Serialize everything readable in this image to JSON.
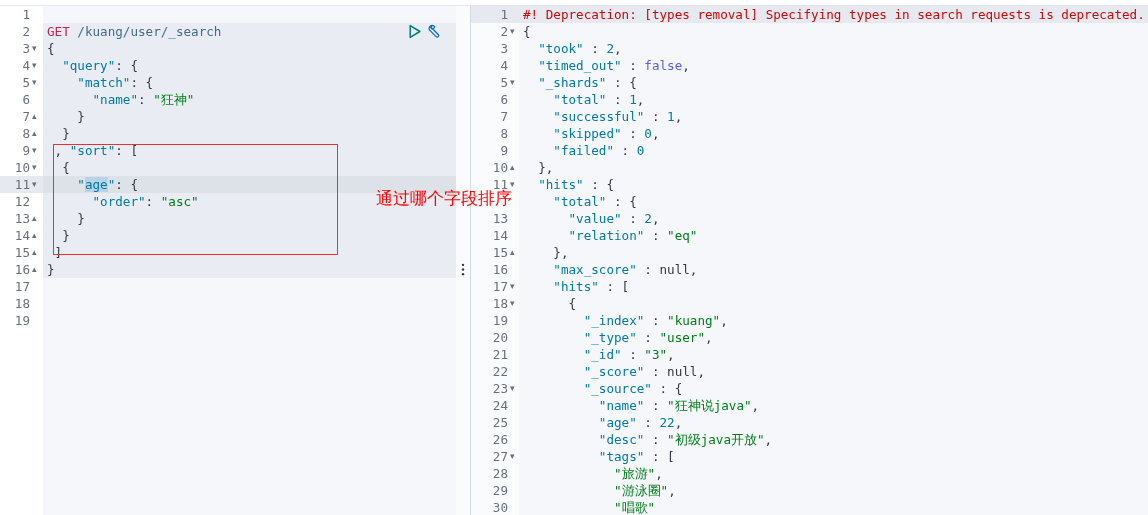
{
  "request_editor": {
    "lines": [
      {
        "number": "1",
        "in_request": false,
        "active": false
      },
      {
        "number": "2",
        "in_request": true,
        "active": false,
        "tokens": [
          {
            "kind": "method",
            "text": "GET"
          },
          {
            "kind": "url",
            "text": " /kuang/user/_search"
          }
        ]
      },
      {
        "number": "3",
        "fold": "▾",
        "in_request": true,
        "active": false,
        "tokens": [
          {
            "kind": "punct",
            "text": "{"
          }
        ]
      },
      {
        "number": "4",
        "fold": "▾",
        "in_request": true,
        "active": false,
        "tokens": [
          {
            "kind": "key",
            "text": "  \"query\""
          },
          {
            "kind": "punct",
            "text": ": {"
          }
        ]
      },
      {
        "number": "5",
        "fold": "▾",
        "in_request": true,
        "active": false,
        "tokens": [
          {
            "kind": "key",
            "text": "    \"match\""
          },
          {
            "kind": "punct",
            "text": ": {"
          }
        ]
      },
      {
        "number": "6",
        "in_request": true,
        "active": false,
        "tokens": [
          {
            "kind": "key",
            "text": "      \"name\""
          },
          {
            "kind": "punct",
            "text": ": "
          },
          {
            "kind": "string",
            "text": "\"狂神\""
          }
        ]
      },
      {
        "number": "7",
        "fold": "▴",
        "in_request": true,
        "active": false,
        "tokens": [
          {
            "kind": "punct",
            "text": "    }"
          }
        ]
      },
      {
        "number": "8",
        "fold": "▴",
        "in_request": true,
        "active": false,
        "tokens": [
          {
            "kind": "punct",
            "text": "  }"
          }
        ]
      },
      {
        "number": "9",
        "fold": "▾",
        "in_request": true,
        "active": false,
        "tokens": [
          {
            "kind": "punct",
            "text": " , "
          },
          {
            "kind": "key",
            "text": "\"sort\""
          },
          {
            "kind": "punct",
            "text": ": ["
          }
        ]
      },
      {
        "number": "10",
        "fold": "▾",
        "in_request": true,
        "active": false,
        "tokens": [
          {
            "kind": "punct",
            "text": "  {"
          }
        ]
      },
      {
        "number": "11",
        "fold": "▾",
        "in_request": true,
        "active": true,
        "tokens": [
          {
            "kind": "key",
            "text": "    \""
          },
          {
            "kind": "selection",
            "text": "age"
          },
          {
            "kind": "key",
            "text": "\""
          },
          {
            "kind": "punct",
            "text": ": {"
          }
        ]
      },
      {
        "number": "12",
        "in_request": true,
        "active": false,
        "tokens": [
          {
            "kind": "key",
            "text": "      \"order\""
          },
          {
            "kind": "punct",
            "text": ": "
          },
          {
            "kind": "string",
            "text": "\"asc\""
          }
        ]
      },
      {
        "number": "13",
        "fold": "▴",
        "in_request": true,
        "active": false,
        "tokens": [
          {
            "kind": "punct",
            "text": "    }"
          }
        ]
      },
      {
        "number": "14",
        "fold": "▴",
        "in_request": true,
        "active": false,
        "tokens": [
          {
            "kind": "punct",
            "text": "  }"
          }
        ]
      },
      {
        "number": "15",
        "fold": "▴",
        "in_request": true,
        "active": false,
        "tokens": [
          {
            "kind": "punct",
            "text": " ]"
          }
        ]
      },
      {
        "number": "16",
        "fold": "▴",
        "in_request": true,
        "active": false,
        "tokens": [
          {
            "kind": "punct",
            "text": "}"
          }
        ]
      },
      {
        "number": "17",
        "in_request": false,
        "active": false
      },
      {
        "number": "18",
        "in_request": false,
        "active": false
      },
      {
        "number": "19",
        "in_request": false,
        "active": false
      }
    ]
  },
  "response_viewer": {
    "lines": [
      {
        "number": "1",
        "active": true,
        "tokens": [
          {
            "kind": "comment",
            "text": "#! Deprecation: [types removal] Specifying types in search requests is deprecated."
          }
        ]
      },
      {
        "number": "2",
        "fold": "▾",
        "active": false,
        "tokens": [
          {
            "kind": "punct",
            "text": "{"
          }
        ]
      },
      {
        "number": "3",
        "active": false,
        "tokens": [
          {
            "kind": "key",
            "text": "  \"took\""
          },
          {
            "kind": "punct",
            "text": " : "
          },
          {
            "kind": "number",
            "text": "2"
          },
          {
            "kind": "punct",
            "text": ","
          }
        ]
      },
      {
        "number": "4",
        "active": false,
        "tokens": [
          {
            "kind": "key",
            "text": "  \"timed_out\""
          },
          {
            "kind": "punct",
            "text": " : "
          },
          {
            "kind": "boolean",
            "text": "false"
          },
          {
            "kind": "punct",
            "text": ","
          }
        ]
      },
      {
        "number": "5",
        "fold": "▾",
        "active": false,
        "tokens": [
          {
            "kind": "key",
            "text": "  \"_shards\""
          },
          {
            "kind": "punct",
            "text": " : {"
          }
        ]
      },
      {
        "number": "6",
        "active": false,
        "tokens": [
          {
            "kind": "key",
            "text": "    \"total\""
          },
          {
            "kind": "punct",
            "text": " : "
          },
          {
            "kind": "number",
            "text": "1"
          },
          {
            "kind": "punct",
            "text": ","
          }
        ]
      },
      {
        "number": "7",
        "active": false,
        "tokens": [
          {
            "kind": "key",
            "text": "    \"successful\""
          },
          {
            "kind": "punct",
            "text": " : "
          },
          {
            "kind": "number",
            "text": "1"
          },
          {
            "kind": "punct",
            "text": ","
          }
        ]
      },
      {
        "number": "8",
        "active": false,
        "tokens": [
          {
            "kind": "key",
            "text": "    \"skipped\""
          },
          {
            "kind": "punct",
            "text": " : "
          },
          {
            "kind": "number",
            "text": "0"
          },
          {
            "kind": "punct",
            "text": ","
          }
        ]
      },
      {
        "number": "9",
        "active": false,
        "tokens": [
          {
            "kind": "key",
            "text": "    \"failed\""
          },
          {
            "kind": "punct",
            "text": " : "
          },
          {
            "kind": "number",
            "text": "0"
          }
        ]
      },
      {
        "number": "10",
        "fold": "▴",
        "active": false,
        "tokens": [
          {
            "kind": "punct",
            "text": "  },"
          }
        ]
      },
      {
        "number": "11",
        "fold": "▾",
        "active": false,
        "tokens": [
          {
            "kind": "key",
            "text": "  \"hits\""
          },
          {
            "kind": "punct",
            "text": " : {"
          }
        ]
      },
      {
        "active": false,
        "tokens": [
          {
            "kind": "key",
            "text": "    \"total\""
          },
          {
            "kind": "punct",
            "text": " : {"
          }
        ]
      },
      {
        "number": "13",
        "active": false,
        "tokens": [
          {
            "kind": "key",
            "text": "      \"value\""
          },
          {
            "kind": "punct",
            "text": " : "
          },
          {
            "kind": "number",
            "text": "2"
          },
          {
            "kind": "punct",
            "text": ","
          }
        ]
      },
      {
        "number": "14",
        "active": false,
        "tokens": [
          {
            "kind": "key",
            "text": "      \"relation\""
          },
          {
            "kind": "punct",
            "text": " : "
          },
          {
            "kind": "string",
            "text": "\"eq\""
          }
        ]
      },
      {
        "number": "15",
        "fold": "▴",
        "active": false,
        "tokens": [
          {
            "kind": "punct",
            "text": "    },"
          }
        ]
      },
      {
        "number": "16",
        "active": false,
        "tokens": [
          {
            "kind": "key",
            "text": "    \"max_score\""
          },
          {
            "kind": "punct",
            "text": " : null,"
          }
        ]
      },
      {
        "number": "17",
        "fold": "▾",
        "active": false,
        "tokens": [
          {
            "kind": "key",
            "text": "    \"hits\""
          },
          {
            "kind": "punct",
            "text": " : ["
          }
        ]
      },
      {
        "number": "18",
        "fold": "▾",
        "active": false,
        "tokens": [
          {
            "kind": "punct",
            "text": "      {"
          }
        ]
      },
      {
        "number": "19",
        "active": false,
        "tokens": [
          {
            "kind": "key",
            "text": "        \"_index\""
          },
          {
            "kind": "punct",
            "text": " : "
          },
          {
            "kind": "string",
            "text": "\"kuang\""
          },
          {
            "kind": "punct",
            "text": ","
          }
        ]
      },
      {
        "number": "20",
        "active": false,
        "tokens": [
          {
            "kind": "key",
            "text": "        \"_type\""
          },
          {
            "kind": "punct",
            "text": " : "
          },
          {
            "kind": "string",
            "text": "\"user\""
          },
          {
            "kind": "punct",
            "text": ","
          }
        ]
      },
      {
        "number": "21",
        "active": false,
        "tokens": [
          {
            "kind": "key",
            "text": "        \"_id\""
          },
          {
            "kind": "punct",
            "text": " : "
          },
          {
            "kind": "string",
            "text": "\"3\""
          },
          {
            "kind": "punct",
            "text": ","
          }
        ]
      },
      {
        "number": "22",
        "active": false,
        "tokens": [
          {
            "kind": "key",
            "text": "        \"_score\""
          },
          {
            "kind": "punct",
            "text": " : null,"
          }
        ]
      },
      {
        "number": "23",
        "fold": "▾",
        "active": false,
        "tokens": [
          {
            "kind": "key",
            "text": "        \"_source\""
          },
          {
            "kind": "punct",
            "text": " : {"
          }
        ]
      },
      {
        "number": "24",
        "active": false,
        "tokens": [
          {
            "kind": "key",
            "text": "          \"name\""
          },
          {
            "kind": "punct",
            "text": " : "
          },
          {
            "kind": "string",
            "text": "\"狂神说java\""
          },
          {
            "kind": "punct",
            "text": ","
          }
        ]
      },
      {
        "number": "25",
        "active": false,
        "tokens": [
          {
            "kind": "key",
            "text": "          \"age\""
          },
          {
            "kind": "punct",
            "text": " : "
          },
          {
            "kind": "number",
            "text": "22"
          },
          {
            "kind": "punct",
            "text": ","
          }
        ]
      },
      {
        "number": "26",
        "active": false,
        "tokens": [
          {
            "kind": "key",
            "text": "          \"desc\""
          },
          {
            "kind": "punct",
            "text": " : "
          },
          {
            "kind": "string",
            "text": "\"初级java开放\""
          },
          {
            "kind": "punct",
            "text": ","
          }
        ]
      },
      {
        "number": "27",
        "fold": "▾",
        "active": false,
        "tokens": [
          {
            "kind": "key",
            "text": "          \"tags\""
          },
          {
            "kind": "punct",
            "text": " : ["
          }
        ]
      },
      {
        "number": "28",
        "active": false,
        "tokens": [
          {
            "kind": "string",
            "text": "            \"旅游\""
          },
          {
            "kind": "punct",
            "text": ","
          }
        ]
      },
      {
        "number": "29",
        "active": false,
        "tokens": [
          {
            "kind": "string",
            "text": "            \"游泳圈\""
          },
          {
            "kind": "punct",
            "text": ","
          }
        ]
      },
      {
        "number": "30",
        "active": false,
        "tokens": [
          {
            "kind": "string",
            "text": "            \"唱歌\""
          }
        ]
      }
    ]
  },
  "annotation": {
    "text": "通过哪个字段排序"
  }
}
